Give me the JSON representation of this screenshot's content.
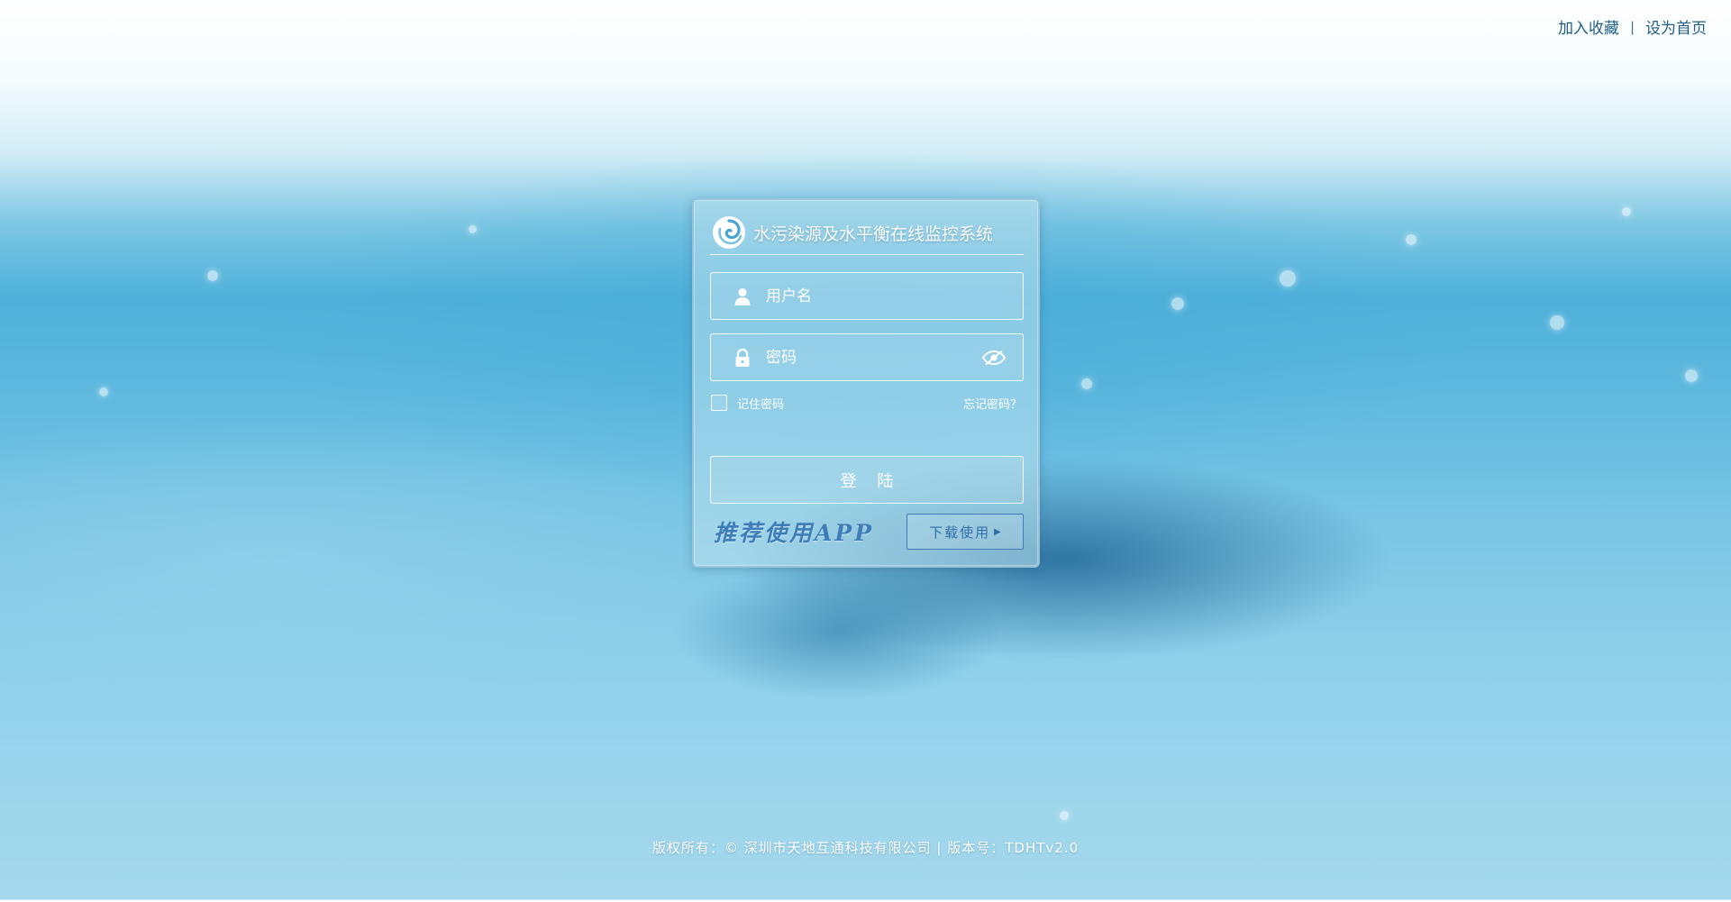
{
  "header": {
    "bookmark_label": "加入收藏",
    "separator": "|",
    "homepage_label": "设为首页"
  },
  "login": {
    "system_title": "水污染源及水平衡在线监控系统",
    "username_placeholder": "用户名",
    "password_placeholder": "密码",
    "remember_label": "记住密码",
    "forgot_label": "忘记密码？",
    "login_label": "登    陆",
    "app_recommend": "推荐使用APP",
    "download_label": "下载使用",
    "download_arrow": "▶"
  },
  "footer": {
    "copyright": "版权所有：© 深圳市天地互通科技有限公司 | 版本号：TDHTv2.0"
  },
  "colors": {
    "link_text": "#1f5f86",
    "app_blue": "#3f7db8",
    "panel_border": "#96c3d7"
  },
  "icons": {
    "logo": "swirl-logo-icon",
    "user": "user-icon",
    "lock": "lock-icon",
    "eye": "eye-hidden-icon"
  }
}
